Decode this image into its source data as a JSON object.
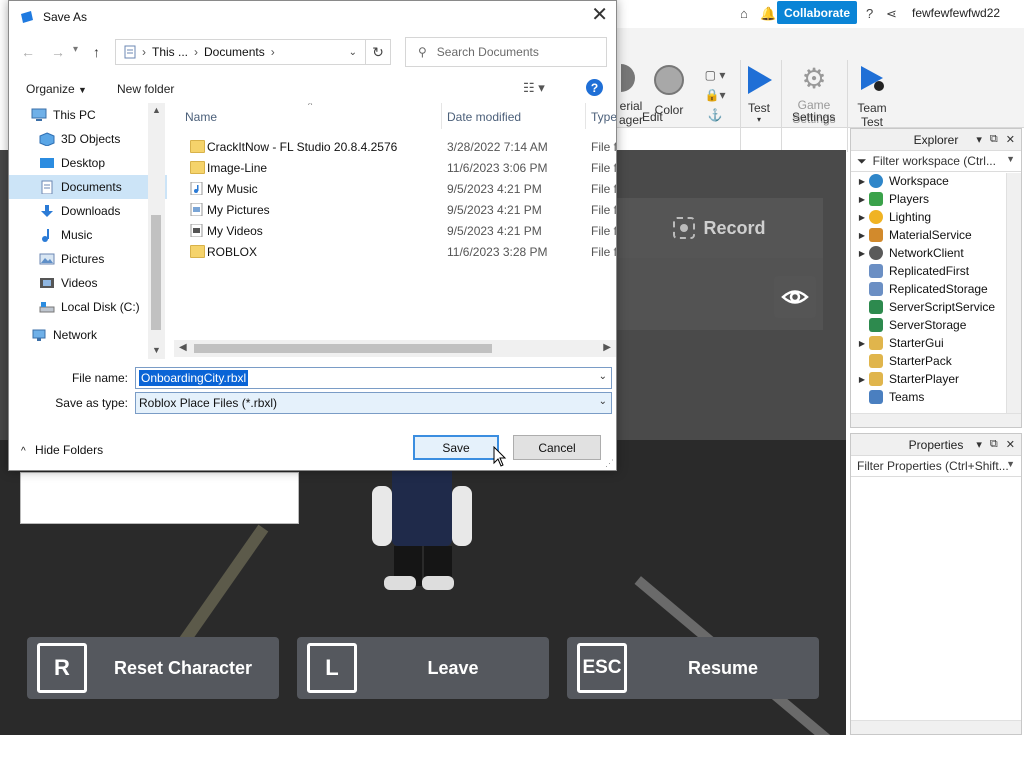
{
  "studio": {
    "topbar": {
      "collaborate_label": "Collaborate",
      "username": "fewfewfewfwd22"
    },
    "ribbon": {
      "material_label_line1": "erial",
      "material_label_line2": "ager",
      "color_label": "Color",
      "edit_label": "Edit",
      "test_label": "Test",
      "game_settings_line1": "Game",
      "game_settings_line2": "Settings",
      "settings_label": "Settings",
      "team_test_line1": "Team",
      "team_test_line2": "Test"
    },
    "viewport": {
      "record_label": "Record",
      "buttons": [
        {
          "key": "R",
          "label": "Reset Character"
        },
        {
          "key": "L",
          "label": "Leave"
        },
        {
          "key": "ESC",
          "label": "Resume"
        }
      ]
    },
    "explorer": {
      "title": "Explorer",
      "filter_placeholder": "Filter workspace (Ctrl...",
      "items": [
        {
          "label": "Workspace",
          "expandable": true,
          "color": "#2f86c9"
        },
        {
          "label": "Players",
          "expandable": true,
          "color": "#3aa24a"
        },
        {
          "label": "Lighting",
          "expandable": true,
          "color": "#f0b323"
        },
        {
          "label": "MaterialService",
          "expandable": true,
          "color": "#d28a2c"
        },
        {
          "label": "NetworkClient",
          "expandable": true,
          "color": "#5a5a5a"
        },
        {
          "label": "ReplicatedFirst",
          "expandable": false,
          "color": "#6b8fc4"
        },
        {
          "label": "ReplicatedStorage",
          "expandable": false,
          "color": "#6b8fc4"
        },
        {
          "label": "ServerScriptService",
          "expandable": false,
          "color": "#2d8a4e"
        },
        {
          "label": "ServerStorage",
          "expandable": false,
          "color": "#2d8a4e"
        },
        {
          "label": "StarterGui",
          "expandable": true,
          "color": "#e0b54c"
        },
        {
          "label": "StarterPack",
          "expandable": false,
          "color": "#e0b54c"
        },
        {
          "label": "StarterPlayer",
          "expandable": true,
          "color": "#e0b54c"
        },
        {
          "label": "Teams",
          "expandable": false,
          "color": "#4a7fc0"
        }
      ]
    },
    "properties": {
      "title": "Properties",
      "filter_placeholder": "Filter Properties (Ctrl+Shift..."
    }
  },
  "dialog": {
    "title": "Save As",
    "breadcrumb": [
      "This ...",
      "Documents"
    ],
    "search_placeholder": "Search Documents",
    "organize_label": "Organize",
    "new_folder_label": "New folder",
    "nav_items": [
      {
        "label": "This PC",
        "icon": "pc-icon",
        "selected": false
      },
      {
        "label": "3D Objects",
        "icon": "3d-objects-icon",
        "selected": false
      },
      {
        "label": "Desktop",
        "icon": "desktop-icon",
        "selected": false
      },
      {
        "label": "Documents",
        "icon": "documents-icon",
        "selected": true
      },
      {
        "label": "Downloads",
        "icon": "downloads-icon",
        "selected": false
      },
      {
        "label": "Music",
        "icon": "music-icon",
        "selected": false
      },
      {
        "label": "Pictures",
        "icon": "pictures-icon",
        "selected": false
      },
      {
        "label": "Videos",
        "icon": "videos-icon",
        "selected": false
      },
      {
        "label": "Local Disk (C:)",
        "icon": "disk-icon",
        "selected": false
      },
      {
        "label": "Network",
        "icon": "network-icon",
        "selected": false
      }
    ],
    "columns": {
      "name": "Name",
      "date": "Date modified",
      "type": "Type"
    },
    "files": [
      {
        "name": "CrackItNow - FL Studio 20.8.4.2576",
        "date": "3/28/2022 7:14 AM",
        "type": "File fo",
        "icon": "folder-icon"
      },
      {
        "name": "Image-Line",
        "date": "11/6/2023 3:06 PM",
        "type": "File fo",
        "icon": "folder-icon"
      },
      {
        "name": "My Music",
        "date": "9/5/2023 4:21 PM",
        "type": "File fo",
        "icon": "music-folder-icon"
      },
      {
        "name": "My Pictures",
        "date": "9/5/2023 4:21 PM",
        "type": "File fo",
        "icon": "pictures-folder-icon"
      },
      {
        "name": "My Videos",
        "date": "9/5/2023 4:21 PM",
        "type": "File fo",
        "icon": "videos-folder-icon"
      },
      {
        "name": "ROBLOX",
        "date": "11/6/2023 3:28 PM",
        "type": "File fo",
        "icon": "folder-icon"
      }
    ],
    "file_name_label": "File name:",
    "file_name_value": "OnboardingCity.rbxl",
    "save_as_type_label": "Save as type:",
    "save_as_type_value": "Roblox Place Files (*.rbxl)",
    "hide_folders_label": "Hide Folders",
    "save_label": "Save",
    "cancel_label": "Cancel"
  }
}
